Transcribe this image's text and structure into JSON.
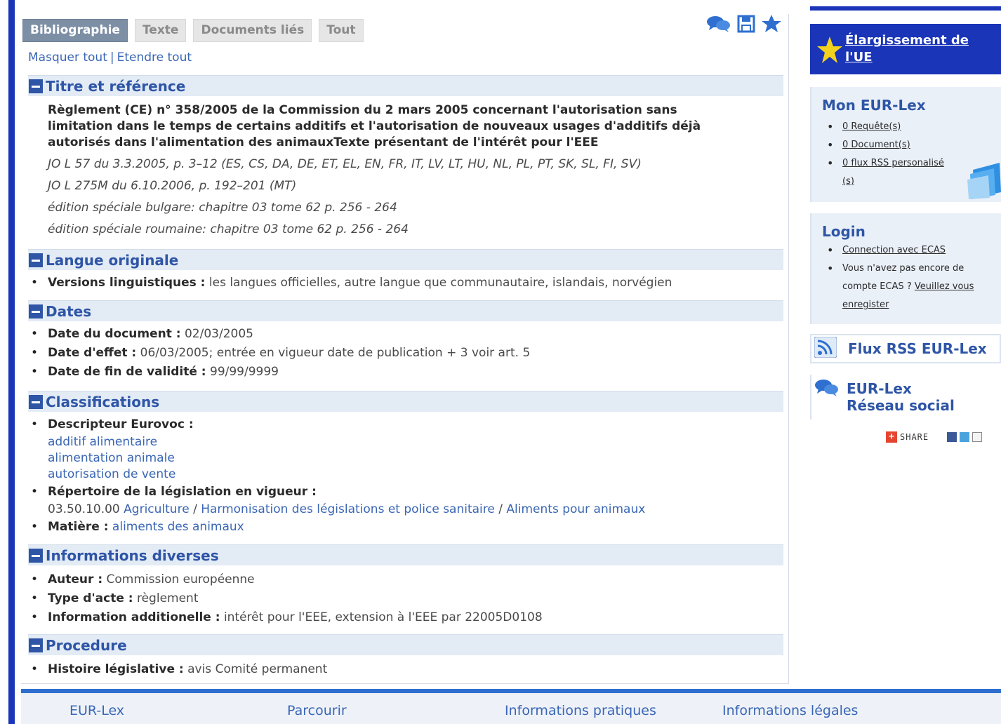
{
  "tabs": [
    {
      "label": "Bibliographie",
      "active": true
    },
    {
      "label": "Texte",
      "active": false
    },
    {
      "label": "Documents liés",
      "active": false
    },
    {
      "label": "Tout",
      "active": false
    }
  ],
  "toolbar_icons": [
    "chat-icon",
    "save-icon",
    "star-icon"
  ],
  "expand_links": {
    "hide_all": "Masquer tout",
    "separator": "|",
    "expand_all": "Etendre tout"
  },
  "sections": {
    "titre": {
      "heading": "Titre et référence",
      "title": "Règlement (CE) n° 358/2005 de la Commission du 2 mars 2005 concernant l'autorisation sans limitation dans le temps de certains additifs et l'autorisation de nouveaux usages d'additifs déjà autorisés dans l'alimentation des animauxTexte présentant de l'intérêt pour l'EEE",
      "refs": [
        "JO L 57 du 3.3.2005, p. 3–12 (ES, CS, DA, DE, ET, EL, EN, FR, IT, LV, LT, HU, NL, PL, PT, SK, SL, FI, SV)",
        "JO L 275M du 6.10.2006, p. 192–201 (MT)",
        "édition spéciale bulgare: chapitre 03 tome 62 p. 256 - 264",
        "édition spéciale roumaine: chapitre 03 tome 62 p. 256 - 264"
      ]
    },
    "langue": {
      "heading": "Langue originale",
      "label": "Versions linguistiques :",
      "value": "les langues officielles, autre langue que communautaire, islandais, norvégien"
    },
    "dates": {
      "heading": "Dates",
      "items": [
        {
          "label": "Date du document :",
          "value": "02/03/2005"
        },
        {
          "label": "Date d'effet :",
          "value": "06/03/2005; entrée en vigueur date de publication + 3 voir art. 5"
        },
        {
          "label": "Date de fin de validité :",
          "value": "99/99/9999"
        }
      ]
    },
    "classifications": {
      "heading": "Classifications",
      "eurovoc_label": "Descripteur Eurovoc :",
      "eurovoc": [
        "additif alimentaire",
        "alimentation animale",
        "autorisation de vente"
      ],
      "repertoire_label": "Répertoire de la législation en vigueur :",
      "repertoire_code": "03.50.10.00",
      "repertoire_path": [
        "Agriculture",
        "Harmonisation des législations et police sanitaire",
        "Aliments pour animaux"
      ],
      "path_sep": "/",
      "matiere_label": "Matière :",
      "matiere_value": "aliments des animaux"
    },
    "infos": {
      "heading": "Informations diverses",
      "items": [
        {
          "label": "Auteur :",
          "value": "Commission européenne"
        },
        {
          "label": "Type d'acte :",
          "value": "règlement"
        },
        {
          "label": "Information additionelle :",
          "value": "intérêt pour l'EEE, extension à l'EEE par 22005D0108"
        }
      ]
    },
    "procedure": {
      "heading": "Procedure",
      "label": "Histoire législative :",
      "value": "avis Comité permanent"
    }
  },
  "sidebar": {
    "enlargement": {
      "line1": "Élargissement de",
      "line2": "l'UE"
    },
    "mon_eurlex": {
      "title": "Mon EUR-Lex",
      "items": [
        "0 Requête(s)",
        "0 Document(s)",
        "0 flux RSS personalisé (s)"
      ]
    },
    "login": {
      "title": "Login",
      "connect": "Connection avec ECAS",
      "no_account": "Vous n'avez pas encore de compte ECAS ?",
      "register": "Veuillez vous enregister"
    },
    "rss": "Flux RSS EUR-Lex",
    "social": {
      "line1": "EUR-Lex",
      "line2": "Réseau social"
    },
    "share": "SHARE"
  },
  "footer": [
    "EUR-Lex",
    "Parcourir",
    "Informations pratiques",
    "Informations légales"
  ],
  "colors": {
    "brand_blue": "#1a35b8",
    "link": "#3a66b4",
    "heading": "#2e55a6",
    "section_bg": "#e3ebf5"
  }
}
